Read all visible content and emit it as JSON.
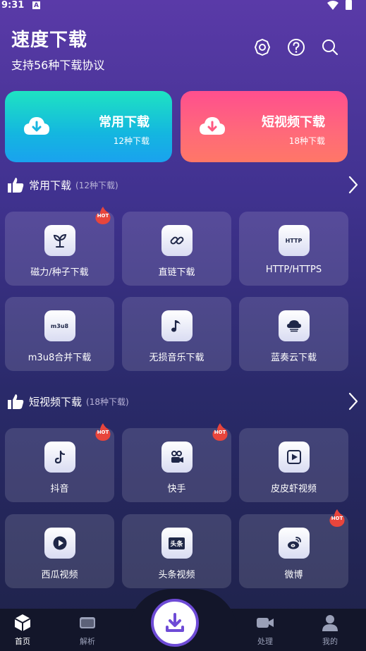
{
  "status_bar": {
    "time": "9:31",
    "notif_letter": "A"
  },
  "header": {
    "title": "速度下载",
    "subtitle": "支持56种下载协议"
  },
  "cards": [
    {
      "title": "常用下载",
      "sub": "12种下载"
    },
    {
      "title": "短视频下载",
      "sub": "18种下载"
    }
  ],
  "sections": [
    {
      "label": "常用下载",
      "count": "(12种下载)",
      "items": [
        {
          "label": "磁力/种子下载",
          "hot": "HOT"
        },
        {
          "label": "直链下载"
        },
        {
          "label": "HTTP/HTTPS",
          "icon_text": "HTTP"
        },
        {
          "label": "m3u8合并下载",
          "icon_text": "m3u8"
        },
        {
          "label": "无损音乐下载"
        },
        {
          "label": "蓝奏云下载"
        }
      ]
    },
    {
      "label": "短视频下载",
      "count": "(18种下载)",
      "items": [
        {
          "label": "抖音",
          "hot": "HOT"
        },
        {
          "label": "快手",
          "hot": "HOT"
        },
        {
          "label": "皮皮虾视频"
        },
        {
          "label": "西瓜视频"
        },
        {
          "label": "头条视频",
          "icon_text": "头条"
        },
        {
          "label": "微博",
          "hot": "HOT"
        }
      ]
    }
  ],
  "nav": [
    {
      "label": "首页"
    },
    {
      "label": "解析"
    },
    {
      "label": "处理"
    },
    {
      "label": "我的"
    }
  ],
  "colors": {
    "accent": "#6e4bd6",
    "teal": "#1ee3c2",
    "pink": "#ff4f8e",
    "hot": "#e8453c"
  }
}
